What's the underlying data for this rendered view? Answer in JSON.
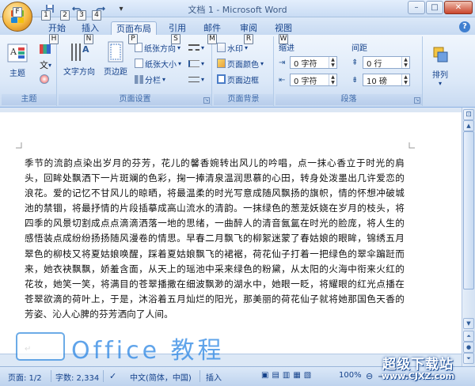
{
  "title_bar": {
    "title": "文档 1 - Microsoft Word",
    "keytips": [
      "F",
      "1",
      "2",
      "3",
      "4"
    ],
    "win_min": "–",
    "win_max": "□",
    "win_close": "✕"
  },
  "tabs": [
    {
      "label": "开始",
      "keytip": "H"
    },
    {
      "label": "插入",
      "keytip": "N"
    },
    {
      "label": "页面布局",
      "keytip": "P"
    },
    {
      "label": "引用",
      "keytip": "S"
    },
    {
      "label": "邮件",
      "keytip": "M"
    },
    {
      "label": "审阅",
      "keytip": "R"
    },
    {
      "label": "视图",
      "keytip": "W"
    }
  ],
  "help_icon": "?",
  "ribbon": {
    "theme_group": {
      "label": "主题",
      "theme_button": "主题",
      "small_icons": [
        "文",
        "▾"
      ]
    },
    "page_setup_group": {
      "label": "页面设置",
      "text_direction": "文字方向",
      "margins": "页边距",
      "orientation": "纸张方向",
      "size": "纸张大小",
      "columns": "分栏"
    },
    "page_background_group": {
      "label": "页面背景",
      "watermark": "水印",
      "page_color": "页面颜色",
      "page_borders": "页面边框"
    },
    "paragraph_group": {
      "label": "段落",
      "indent_title": "缩进",
      "spacing_title": "间距",
      "indent_left": "0 字符",
      "indent_right": "0 字符",
      "spacing_before": "0 行",
      "spacing_after": "10 磅"
    },
    "arrange_group": {
      "arrange": "排列"
    }
  },
  "document": {
    "body_text": "季节的流韵点染出岁月的芬芳，花儿的馨香婉转出风儿的吟唱，点一抹心香立于时光的肩头，回眸处飘洒下一片斑斓的色彩，掬一捧清泉温润思慕的心田，转身处泼墨出几许爱恋的浪花。爱的记忆不甘风儿的晾晒，将最温柔的时光写意成随风飘扬的旗帜，情的怀想冲破城池的禁锢，将最抒情的片段插摹成高山流水的清韵。一抹绿色的葱茏妖娆在岁月的枝头，将四季的风景切割成点点滴滴洒落一地的思绪，一曲醉人的清音氤氲在时光的脸庞，将人生的感悟装点成纷纷扬扬随风漫卷的情思。早春二月飘飞的柳絮迷蒙了春姑娘的眼眸，锦绣五月翠色的柳枝又将夏姑娘唤醒，踩着夏姑娘飘飞的裙裾，荷花仙子打着一把绿色的翠伞蹁跹而来，她衣袂飘飘，娇羞含面，从天上的瑶池中采来绿色的粉黛，从太阳的火海中衔来火红的花妆，她笑一笑，将满目的苍翠播撒在细波飘渺的湖水中，她眼一眨，将耀眼的红光点播在苍翠欲滴的荷叶上，于是，沐浴着五月灿烂的阳光，那美丽的荷花仙子就将她那国色天香的芳姿、沁人心脾的芬芳洒向了人间。",
    "paragraph_mark": "↵"
  },
  "status_bar": {
    "page": "页面: 1/2",
    "words": "字数: 2,334",
    "language": "中文(简体，中国)",
    "mode": "插入",
    "zoom": "100%"
  },
  "watermarks": {
    "office_text": "Office 教程",
    "site_line1": "超级下载站",
    "site_line2": "www.CJXZ.com"
  },
  "colors": {
    "ribbon_text": "#15428b",
    "accent": "#3e6aaa"
  }
}
